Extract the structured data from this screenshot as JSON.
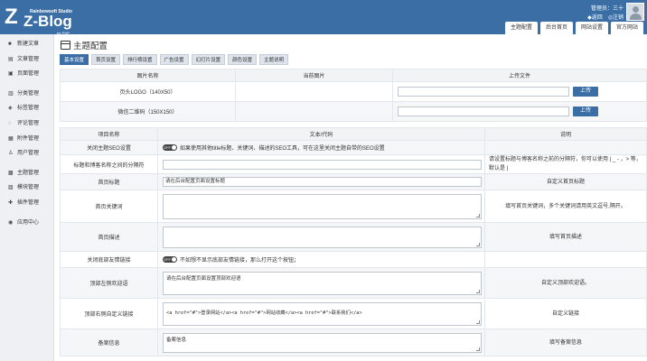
{
  "logo": {
    "studio": "Rainbowsoft Studio",
    "name": "Z-Blog",
    "for": "for PHP"
  },
  "user": {
    "line1": "管理员：三十",
    "return": "◆返回",
    "logout": "◎注销"
  },
  "topnav": [
    "主题配置",
    "后台首页",
    "网站设置",
    "官方网站"
  ],
  "sidebar": [
    {
      "icon": "■",
      "label": "新建文章"
    },
    {
      "icon": "▤",
      "label": "文章管理"
    },
    {
      "icon": "▣",
      "label": "页面管理"
    },
    null,
    {
      "icon": "▥",
      "label": "分类管理"
    },
    {
      "icon": "◈",
      "label": "标签管理"
    },
    {
      "icon": "◌",
      "label": "评论管理"
    },
    {
      "icon": "▦",
      "label": "附件管理"
    },
    {
      "icon": "♙",
      "label": "用户管理"
    },
    null,
    {
      "icon": "▩",
      "label": "主题管理"
    },
    {
      "icon": "▨",
      "label": "模块管理"
    },
    {
      "icon": "✚",
      "label": "插件管理"
    },
    null,
    {
      "icon": "◉",
      "label": "应用中心"
    }
  ],
  "page_title": "主题配置",
  "subtabs": [
    "基本设置",
    "首页设置",
    "排行榜设置",
    "广告设置",
    "幻灯片设置",
    "颜色设置",
    "主题说明"
  ],
  "upload_table": {
    "headers": [
      "图片名称",
      "当前图片",
      "上传文件"
    ],
    "rows": [
      {
        "name": "页头LOGO（140X50）",
        "button": "上传"
      },
      {
        "name": "微信二维码（150X150）",
        "button": "上传"
      }
    ]
  },
  "settings_table": {
    "headers": [
      "项目名称",
      "文本/代码",
      "说明"
    ],
    "rows": [
      {
        "name": "关闭主题SEO设置",
        "type": "toggle",
        "toggle": "OFF",
        "text": "如果使用其他title标题、关键词、描述的SEO工具，可在这里关闭主题自带的SEO设置",
        "note": ""
      },
      {
        "name": "标题和博客名称之间的分隔符",
        "type": "input",
        "text": "",
        "note": "请设置标题与博客名称之前的分隔符，你可以使用 | _ - ，> 等，默认是 |"
      },
      {
        "name": "首页标题",
        "type": "input",
        "text": "请在后台配置页面设置标题",
        "note": "自定义首页标题"
      },
      {
        "name": "首页关键词",
        "type": "textarea",
        "text": "",
        "note": "填写首页关键词，多个关键词请用英文逗号,隔开。"
      },
      {
        "name": "首页描述",
        "type": "textarea",
        "text": "",
        "note": "填写首页描述"
      },
      {
        "name": "关闭底部友情链接",
        "type": "toggle",
        "toggle": "OFF",
        "text": "不如想不显示底部友情链接，那么打开这个按钮；",
        "note": ""
      },
      {
        "name": "顶部左侧欢迎语",
        "type": "textarea",
        "text": "请在后台配置页面设置顶部欢迎语",
        "note": "自定义顶部欢迎语。"
      },
      {
        "name": "顶部右侧自定义链接",
        "type": "textarea",
        "text": "<a href=\"#\">登录网站</a><a href=\"#\">网站收藏</a><a href=\"#\">联系我们</a>",
        "note": "自定义链接"
      },
      {
        "name": "备案信息",
        "type": "textarea",
        "text": "备案信息",
        "note": "填写备案信息"
      }
    ]
  },
  "colors": {
    "primary": "#3a6ea5"
  }
}
